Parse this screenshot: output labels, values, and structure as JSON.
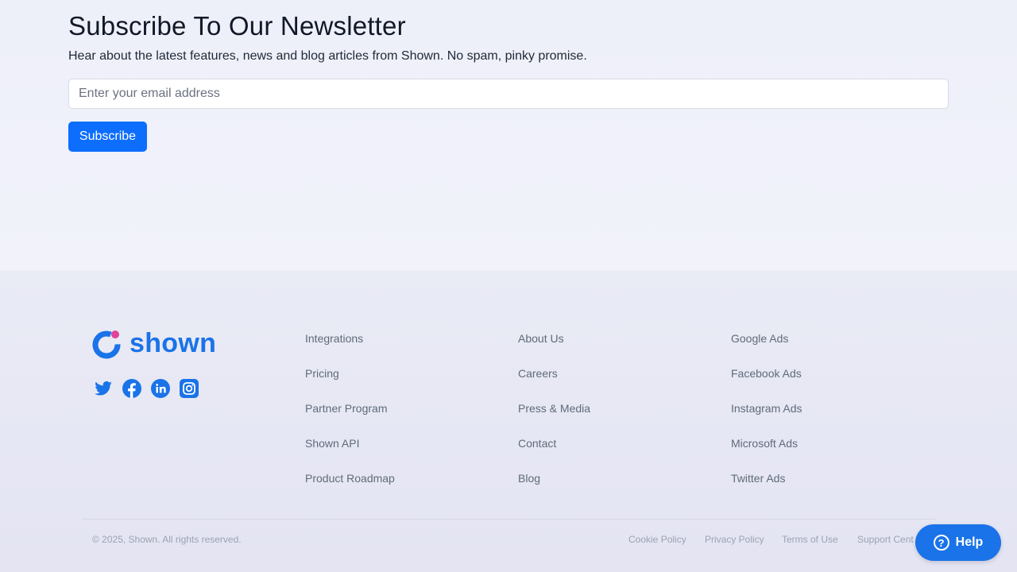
{
  "newsletter": {
    "title": "Subscribe To Our Newsletter",
    "subtitle": "Hear about the latest features, news and blog articles from Shown. No spam, pinky promise.",
    "email_placeholder": "Enter your email address",
    "email_value": "",
    "subscribe_label": "Subscribe"
  },
  "footer": {
    "brand": "shown",
    "brand_color": "#1a73e8",
    "accent_dot_color": "#e0439a",
    "socials": [
      "twitter-icon",
      "facebook-icon",
      "linkedin-icon",
      "instagram-icon"
    ],
    "col1": [
      "Integrations",
      "Pricing",
      "Partner Program",
      "Shown API",
      "Product Roadmap"
    ],
    "col2": [
      "About Us",
      "Careers",
      "Press & Media",
      "Contact",
      "Blog"
    ],
    "col3": [
      "Google Ads",
      "Facebook Ads",
      "Instagram Ads",
      "Microsoft Ads",
      "Twitter Ads"
    ],
    "copyright": "© 2025, Shown. All rights reserved.",
    "legal": {
      "cookie": "Cookie Policy",
      "privacy": "Privacy Policy",
      "terms": "Terms of Use",
      "support": "Support Cent"
    }
  },
  "help": {
    "label": "Help",
    "icon": "?"
  },
  "colors": {
    "primary_button": "#0d6efd"
  }
}
